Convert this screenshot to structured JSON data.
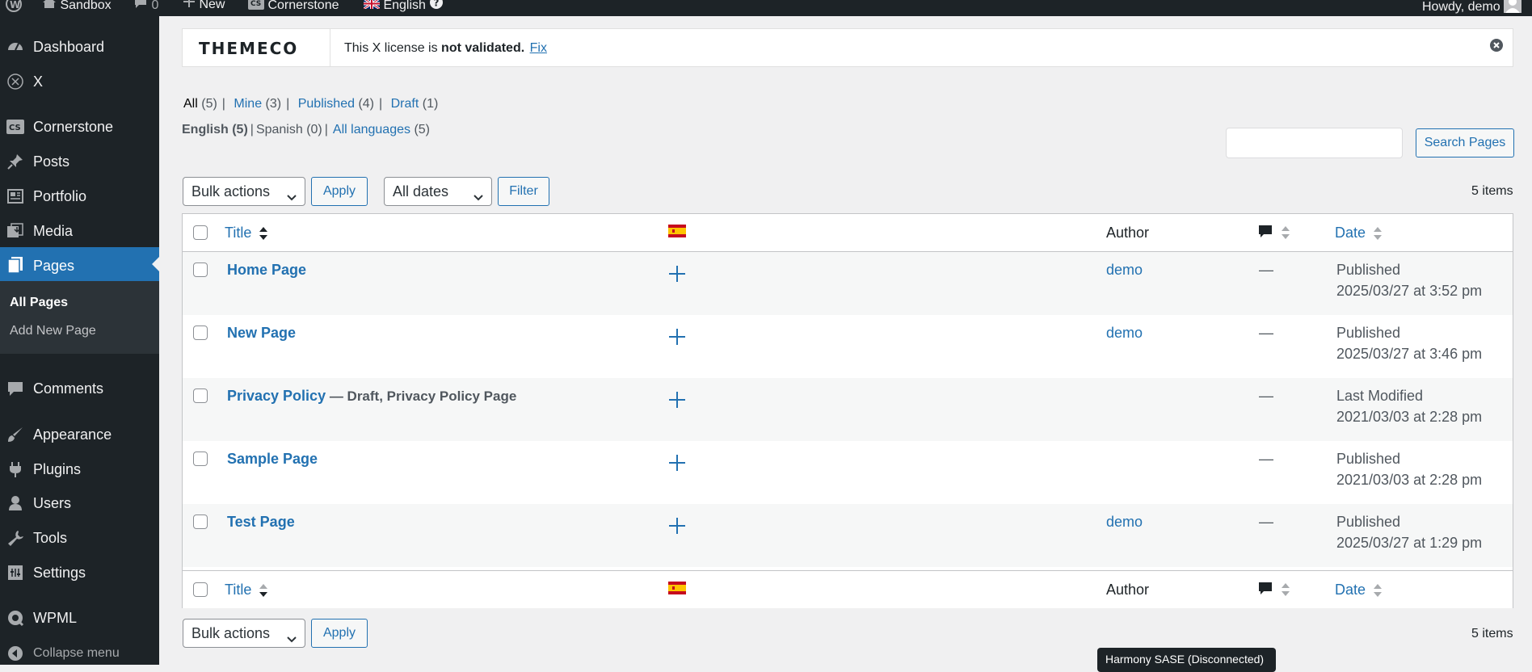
{
  "admin_bar": {
    "site_name": "Sandbox",
    "comments_count": "0",
    "new_label": "New",
    "cornerstone_label": "Cornerstone",
    "language_label": "English",
    "howdy": "Howdy, demo"
  },
  "sidebar": {
    "items": [
      {
        "label": "Dashboard",
        "icon": "dashboard-icon"
      },
      {
        "label": "X",
        "icon": "x-circle-icon"
      },
      {
        "label": "Cornerstone",
        "icon": "cornerstone-icon"
      },
      {
        "label": "Posts",
        "icon": "pin-icon"
      },
      {
        "label": "Portfolio",
        "icon": "portfolio-icon"
      },
      {
        "label": "Media",
        "icon": "media-icon"
      },
      {
        "label": "Pages",
        "icon": "pages-icon"
      },
      {
        "label": "Comments",
        "icon": "comment-icon"
      },
      {
        "label": "Appearance",
        "icon": "brush-icon"
      },
      {
        "label": "Plugins",
        "icon": "plugin-icon"
      },
      {
        "label": "Users",
        "icon": "user-icon"
      },
      {
        "label": "Tools",
        "icon": "wrench-icon"
      },
      {
        "label": "Settings",
        "icon": "settings-icon"
      },
      {
        "label": "WPML",
        "icon": "wpml-icon"
      },
      {
        "label": "Collapse menu",
        "icon": "collapse-icon"
      }
    ],
    "submenu": [
      "All Pages",
      "Add New Page"
    ]
  },
  "notice": {
    "logo_text": "THEMECO",
    "msg_prefix": "This X license is ",
    "msg_bold": "not validated.",
    "fix_link": "Fix"
  },
  "views": {
    "all": {
      "label": "All",
      "count": "(5)"
    },
    "mine": {
      "label": "Mine",
      "count": "(3)"
    },
    "published": {
      "label": "Published",
      "count": "(4)"
    },
    "draft": {
      "label": "Draft",
      "count": "(1)"
    }
  },
  "languages": {
    "english": "English (5)",
    "spanish": "Spanish (0)",
    "all_label": "All languages",
    "all_count": "(5)"
  },
  "search": {
    "button_label": "Search Pages",
    "value": ""
  },
  "top_nav": {
    "bulk_actions": "Bulk actions",
    "apply": "Apply",
    "all_dates": "All dates",
    "filter": "Filter",
    "items_count": "5 items"
  },
  "table": {
    "col_title": "Title",
    "col_author": "Author",
    "col_date": "Date",
    "rows": [
      {
        "title": "Home Page",
        "state": "",
        "author": "demo",
        "comments": "—",
        "status": "Published",
        "date": "2025/03/27 at 3:52 pm"
      },
      {
        "title": "New Page",
        "state": "",
        "author": "demo",
        "comments": "—",
        "status": "Published",
        "date": "2025/03/27 at 3:46 pm"
      },
      {
        "title": "Privacy Policy",
        "state": " — Draft, Privacy Policy Page",
        "author": "",
        "comments": "—",
        "status": "Last Modified",
        "date": "2021/03/03 at 2:28 pm"
      },
      {
        "title": "Sample Page",
        "state": "",
        "author": "",
        "comments": "—",
        "status": "Published",
        "date": "2021/03/03 at 2:28 pm"
      },
      {
        "title": "Test Page",
        "state": "",
        "author": "demo",
        "comments": "—",
        "status": "Published",
        "date": "2025/03/27 at 1:29 pm"
      }
    ]
  },
  "bottom_nav": {
    "bulk_actions": "Bulk actions",
    "apply": "Apply",
    "items_count": "5 items"
  },
  "tooltip": "Harmony SASE (Disconnected)",
  "colors": {
    "accent": "#2271b1",
    "sidebar_bg": "#1d2327",
    "current_bg": "#2271b1"
  }
}
